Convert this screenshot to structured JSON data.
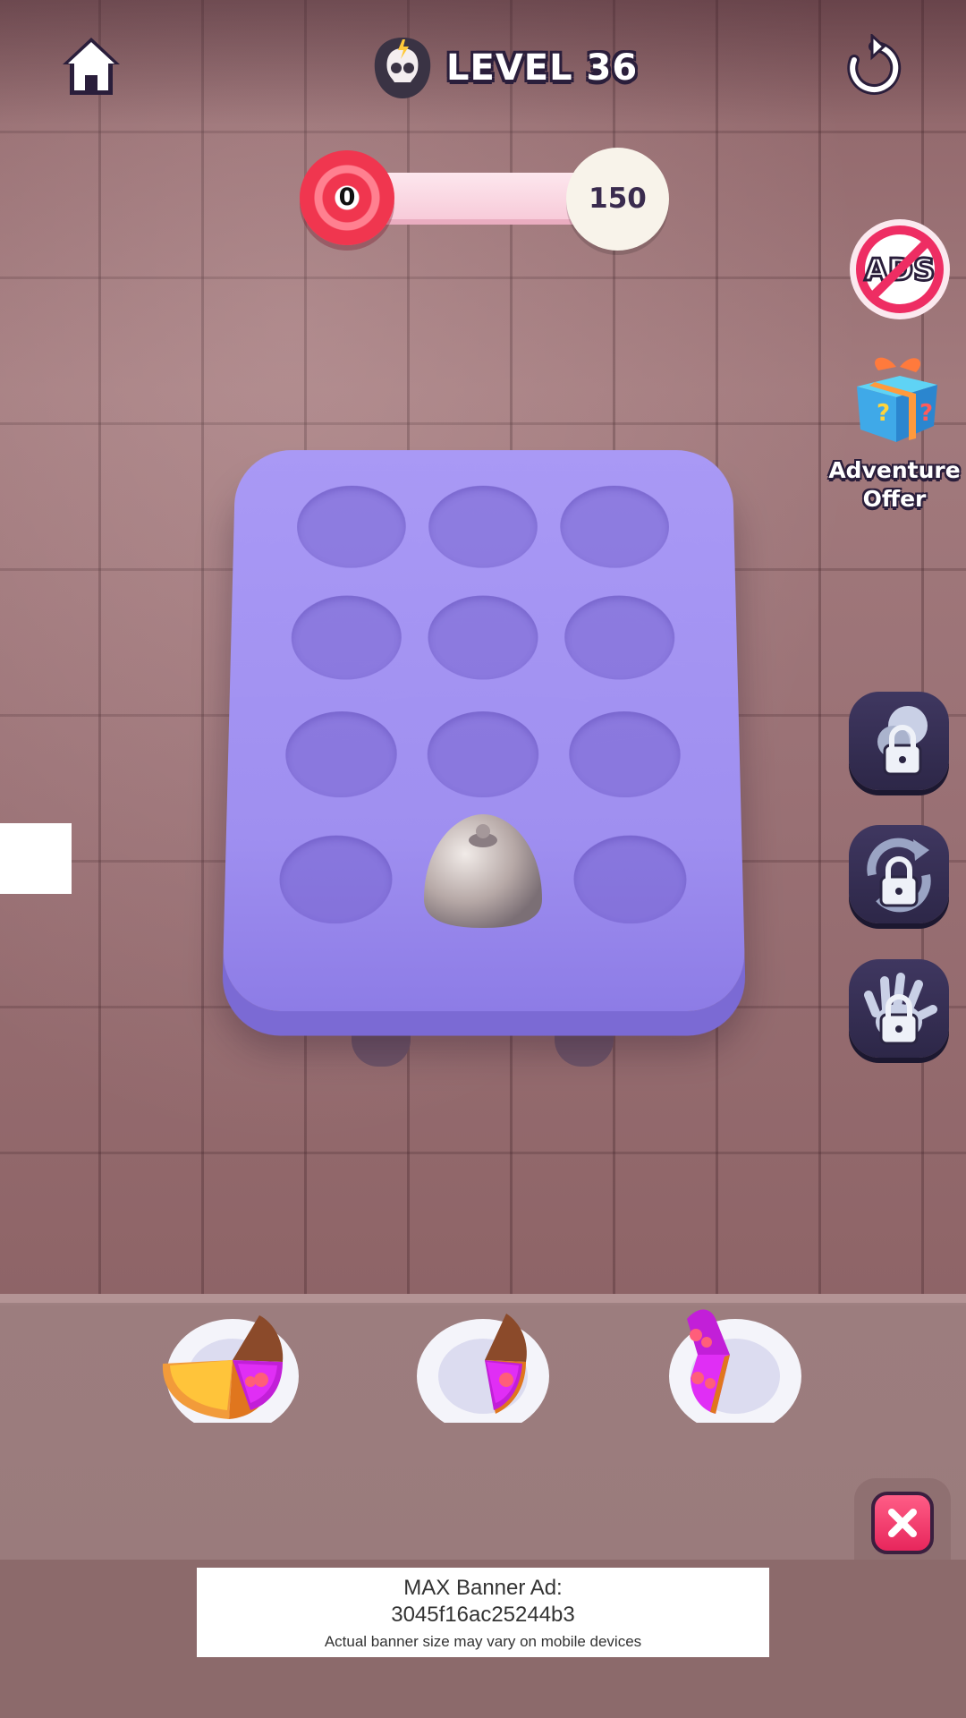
{
  "header": {
    "level_label": "LEVEL 36",
    "home_icon": "home-icon",
    "restart_icon": "restart-icon",
    "level_icon": "skull-icon"
  },
  "progress": {
    "current": "0",
    "goal": "150",
    "fraction": 0
  },
  "side_menu": {
    "no_ads_label": "ADS",
    "adventure_offer_label": "Adventure Offer",
    "boosters": [
      {
        "name": "hammer-booster",
        "locked": true
      },
      {
        "name": "shuffle-booster",
        "locked": true
      },
      {
        "name": "grab-booster",
        "locked": true
      }
    ]
  },
  "board": {
    "rows": 4,
    "cols": 3,
    "covered_slot": "row 4, col 2"
  },
  "tray": {
    "plates": [
      {
        "slices": [
          "orange",
          "orange",
          "chocolate",
          "purple"
        ]
      },
      {
        "slices": [
          "chocolate",
          "purple"
        ]
      },
      {
        "slices": [
          "purple",
          "purple"
        ]
      }
    ]
  },
  "ad": {
    "title": "MAX Banner Ad:",
    "id": "3045f16ac25244b3",
    "note": "Actual banner size may vary on mobile devices"
  },
  "colors": {
    "board": "#a999f5",
    "target_red": "#f0364f",
    "close_pink": "#ff5d86",
    "booster_bg": "#3f3760"
  }
}
